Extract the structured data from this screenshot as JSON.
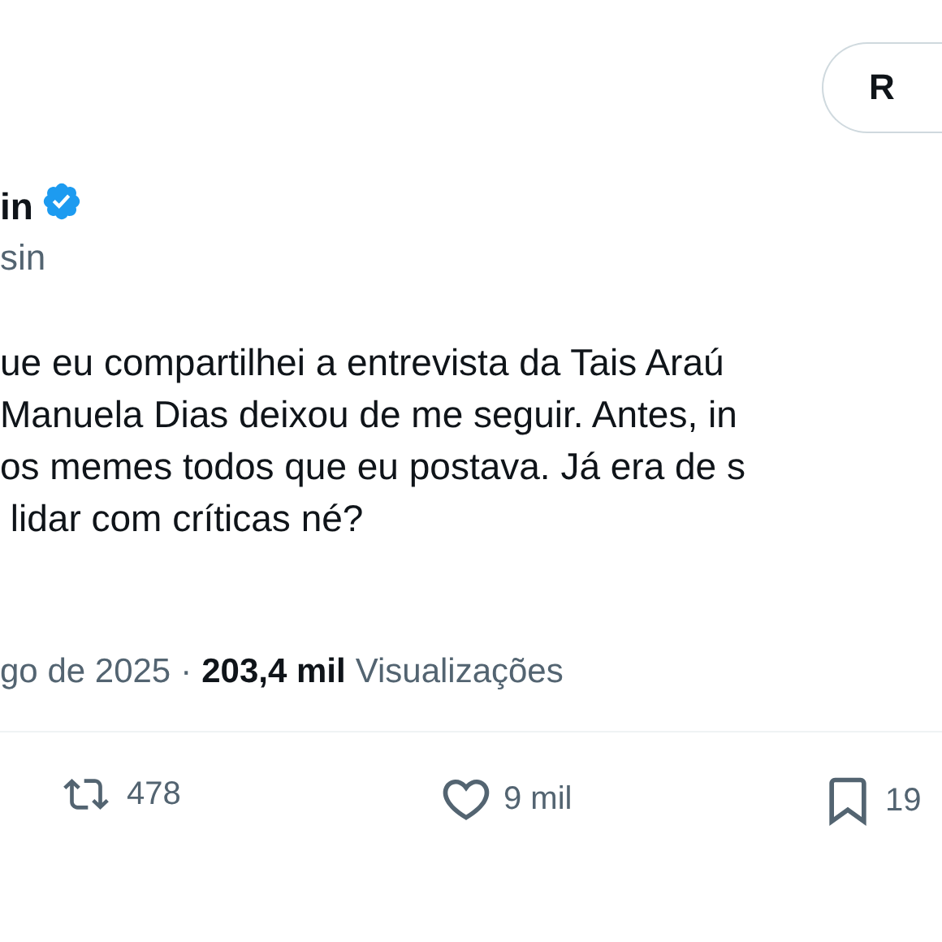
{
  "header": {
    "button_label": "R"
  },
  "author": {
    "name": "in",
    "verified": true,
    "handle": "sin"
  },
  "post": {
    "text": "ue eu compartilhei a entrevista da Tais Araú\nManuela Dias deixou de me seguir. Antes, in\nos memes todos que eu postava. Já era de s\n lidar com críticas né?"
  },
  "meta": {
    "date": "go de 2025",
    "separator": "·",
    "views_count": "203,4 mil",
    "views_label": "Visualizações"
  },
  "actions": [
    {
      "kind": "repost",
      "count": "478"
    },
    {
      "kind": "like",
      "count": "9 mil"
    },
    {
      "kind": "bookmark",
      "count": "19"
    }
  ]
}
